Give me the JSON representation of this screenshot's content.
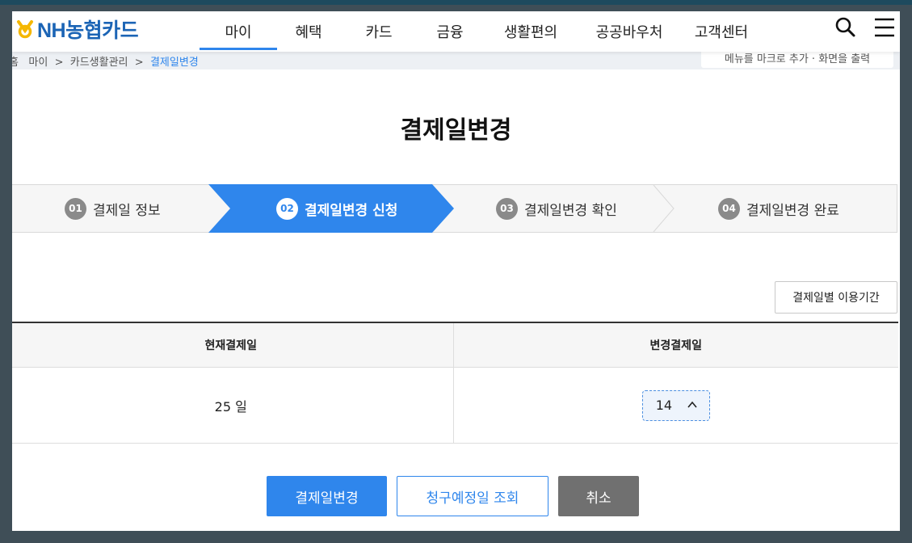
{
  "brand": {
    "logo_text": "NH농협카드"
  },
  "nav": {
    "items": [
      "마이",
      "혜택",
      "카드",
      "금융",
      "생활편의",
      "공공바우처",
      "고객센터"
    ],
    "active": "마이"
  },
  "header_icons": [
    "search-icon",
    "menu-icon"
  ],
  "breadcrumb": {
    "items": [
      "홈",
      "마이",
      "카드생활관리",
      "결제일변경"
    ],
    "right_text": "메뉴를 마크로 추가 · 화면을 출력"
  },
  "page": {
    "title": "결제일변경"
  },
  "steps": [
    {
      "num": "01",
      "label": "결제일 정보"
    },
    {
      "num": "02",
      "label": "결제일변경 신청"
    },
    {
      "num": "03",
      "label": "결제일변경 확인"
    },
    {
      "num": "04",
      "label": "결제일변경 완료"
    }
  ],
  "current_step": 2,
  "period_button": "결제일별 이용기간",
  "table": {
    "headers": [
      "현재결제일",
      "변경결제일"
    ],
    "current_day": "25 일",
    "new_day_value": "14"
  },
  "buttons": {
    "change": "결제일변경",
    "inquiry": "청구예정일 조회",
    "cancel": "취소"
  },
  "colors": {
    "accent": "#2f86ec",
    "brand": "#1b64b5",
    "cancel": "#707070"
  }
}
